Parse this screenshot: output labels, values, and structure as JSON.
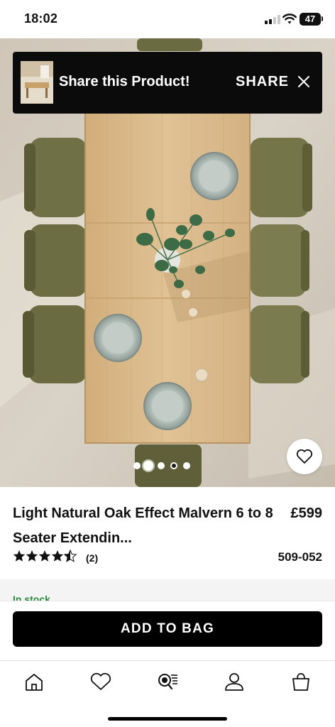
{
  "status_bar": {
    "time": "18:02",
    "battery": "47"
  },
  "share_banner": {
    "title": "Share this Product!",
    "action_label": "SHARE"
  },
  "gallery": {
    "total_images": 5,
    "active_index": 1
  },
  "product": {
    "name": "Light Natural Oak Effect Malvern 6 to 8 Seater Extendin...",
    "price": "£599",
    "rating": 4.5,
    "review_count": "(2)",
    "code": "509-052"
  },
  "stock": {
    "status": "In stock"
  },
  "cta": {
    "add_to_bag": "ADD TO BAG"
  },
  "bottom_nav": {
    "items": [
      "home-icon",
      "heart-icon",
      "search-icon",
      "account-icon",
      "bag-icon"
    ]
  },
  "colors": {
    "brand": "#000000",
    "background": "#ffffff",
    "oak": "#dbb98a",
    "chair": "#6f7045"
  }
}
